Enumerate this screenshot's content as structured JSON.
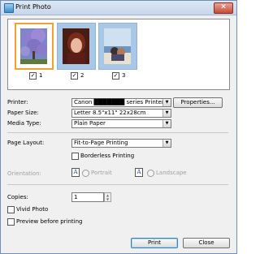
{
  "window": {
    "title": "Print Photo",
    "close_glyph": "✕"
  },
  "thumbnails": [
    {
      "number": "1",
      "checked": true,
      "selected": true,
      "checkmark": "✓"
    },
    {
      "number": "2",
      "checked": true,
      "selected": false,
      "checkmark": "✓"
    },
    {
      "number": "3",
      "checked": true,
      "selected": false,
      "checkmark": "✓"
    }
  ],
  "printer": {
    "label": "Printer:",
    "value": "Canon ███████ series Printer",
    "properties_label": "Properties..."
  },
  "paper_size": {
    "label": "Paper Size:",
    "value": "Letter 8.5\"x11\" 22x28cm"
  },
  "media_type": {
    "label": "Media Type:",
    "value": "Plain Paper"
  },
  "page_layout": {
    "label": "Page Layout:",
    "value": "Fit-to-Page Printing",
    "borderless_label": "Borderless Printing"
  },
  "orientation": {
    "label": "Orientation:",
    "portrait_label": "Portrait",
    "landscape_label": "Landscape",
    "portrait_glyph": "A",
    "landscape_glyph": "A"
  },
  "copies": {
    "label": "Copies:",
    "value": "1"
  },
  "options": {
    "vivid_label": "Vivid Photo",
    "preview_label": "Preview before printing"
  },
  "actions": {
    "print_label": "Print",
    "close_label": "Close"
  },
  "combo_arrow": "▼",
  "spin_up": "▲",
  "spin_down": "▼"
}
